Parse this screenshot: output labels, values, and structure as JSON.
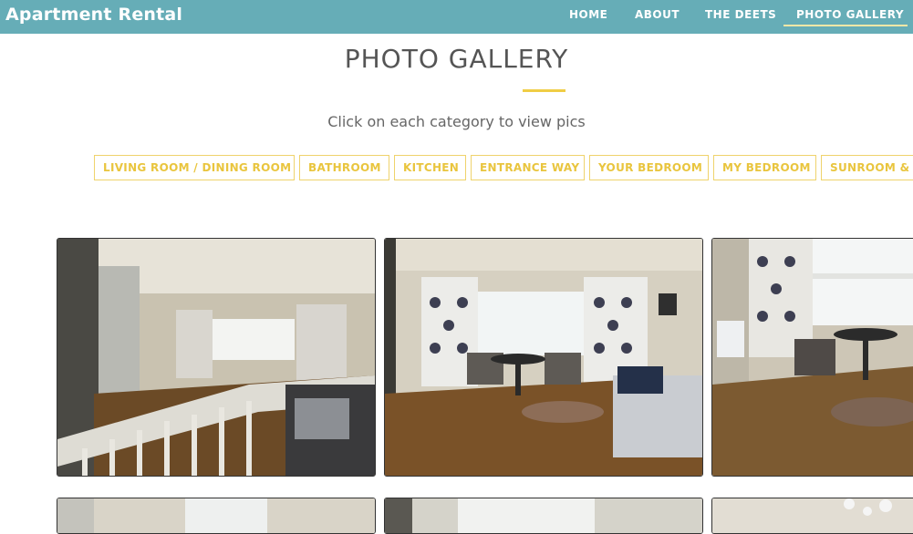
{
  "nav": {
    "brand": "Apartment Rental",
    "links": [
      "HOME",
      "ABOUT",
      "THE DEETS",
      "PHOTO GALLERY"
    ],
    "active": "PHOTO GALLERY"
  },
  "gallery": {
    "title": "PHOTO GALLERY",
    "subtitle": "Click on each category to view pics",
    "filters": [
      "LIVING ROOM / DINING ROOM",
      "BATHROOM",
      "KITCHEN",
      "ENTRANCE WAY",
      "YOUR BEDROOM",
      "MY BEDROOM",
      "SUNROOM & I"
    ]
  },
  "colors": {
    "navbar": "#66adb7",
    "accent": "#f0cd45",
    "text_gray": "#555555"
  }
}
